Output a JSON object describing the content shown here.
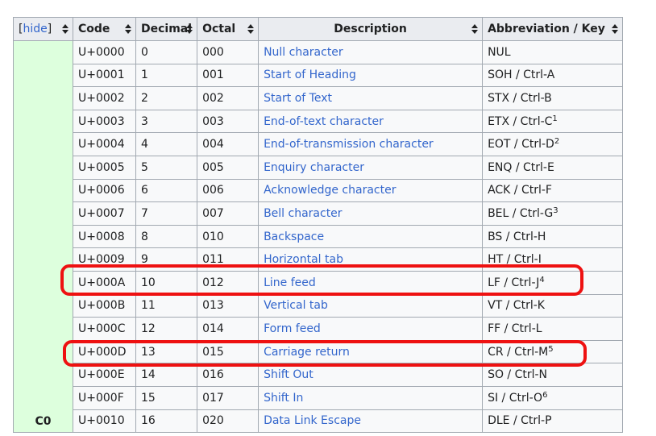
{
  "table": {
    "hide_open": "[",
    "hide_label": "hide",
    "hide_close": "]",
    "headers": {
      "code": "Code",
      "decimal": "Decimal",
      "octal": "Octal",
      "description": "Description",
      "abbreviation": "Abbreviation / Key"
    },
    "group_label": "C0",
    "rows": [
      {
        "code": "U+0000",
        "dec": "0",
        "oct": "000",
        "desc": "Null character",
        "abbr": "NUL",
        "note": ""
      },
      {
        "code": "U+0001",
        "dec": "1",
        "oct": "001",
        "desc": "Start of Heading",
        "abbr": "SOH / Ctrl-A",
        "note": ""
      },
      {
        "code": "U+0002",
        "dec": "2",
        "oct": "002",
        "desc": "Start of Text",
        "abbr": "STX / Ctrl-B",
        "note": ""
      },
      {
        "code": "U+0003",
        "dec": "3",
        "oct": "003",
        "desc": "End-of-text character",
        "abbr": "ETX / Ctrl-C",
        "note": "1"
      },
      {
        "code": "U+0004",
        "dec": "4",
        "oct": "004",
        "desc": "End-of-transmission character",
        "abbr": "EOT / Ctrl-D",
        "note": "2"
      },
      {
        "code": "U+0005",
        "dec": "5",
        "oct": "005",
        "desc": "Enquiry character",
        "abbr": "ENQ / Ctrl-E",
        "note": ""
      },
      {
        "code": "U+0006",
        "dec": "6",
        "oct": "006",
        "desc": "Acknowledge character",
        "abbr": "ACK / Ctrl-F",
        "note": ""
      },
      {
        "code": "U+0007",
        "dec": "7",
        "oct": "007",
        "desc": "Bell character",
        "abbr": "BEL / Ctrl-G",
        "note": "3"
      },
      {
        "code": "U+0008",
        "dec": "8",
        "oct": "010",
        "desc": "Backspace",
        "abbr": "BS / Ctrl-H",
        "note": ""
      },
      {
        "code": "U+0009",
        "dec": "9",
        "oct": "011",
        "desc": "Horizontal tab",
        "abbr": "HT / Ctrl-I",
        "note": ""
      },
      {
        "code": "U+000A",
        "dec": "10",
        "oct": "012",
        "desc": "Line feed",
        "abbr": "LF / Ctrl-J",
        "note": "4"
      },
      {
        "code": "U+000B",
        "dec": "11",
        "oct": "013",
        "desc": "Vertical tab",
        "abbr": "VT / Ctrl-K",
        "note": ""
      },
      {
        "code": "U+000C",
        "dec": "12",
        "oct": "014",
        "desc": "Form feed",
        "abbr": "FF / Ctrl-L",
        "note": ""
      },
      {
        "code": "U+000D",
        "dec": "13",
        "oct": "015",
        "desc": "Carriage return",
        "abbr": "CR / Ctrl-M",
        "note": "5"
      },
      {
        "code": "U+000E",
        "dec": "14",
        "oct": "016",
        "desc": "Shift Out",
        "abbr": "SO / Ctrl-N",
        "note": ""
      },
      {
        "code": "U+000F",
        "dec": "15",
        "oct": "017",
        "desc": "Shift In",
        "abbr": "SI / Ctrl-O",
        "note": "6"
      },
      {
        "code": "U+0010",
        "dec": "16",
        "oct": "020",
        "desc": "Data Link Escape",
        "abbr": "DLE / Ctrl-P",
        "note": ""
      }
    ]
  },
  "highlighted_rows": [
    "U+000A",
    "U+000D"
  ],
  "colors": {
    "link": "#3366cc",
    "header_bg": "#eaecf0",
    "group_bg": "#ddffdd",
    "highlight": "#ee1111"
  }
}
